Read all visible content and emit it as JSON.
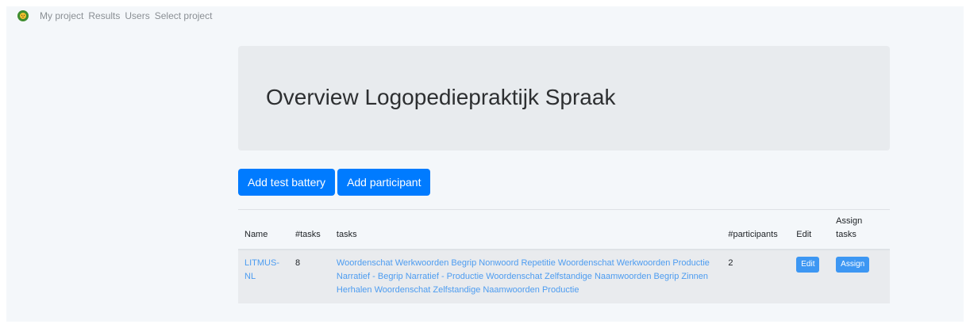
{
  "navbar": {
    "logo_icon": "lion-logo-icon",
    "links": [
      "My project",
      "Results",
      "Users",
      "Select project"
    ]
  },
  "jumbotron": {
    "title": "Overview Logopediepraktijk Spraak"
  },
  "actions": {
    "add_test_battery": "Add test battery",
    "add_participant": "Add participant"
  },
  "table": {
    "headers": {
      "name": "Name",
      "ntasks": "#tasks",
      "tasks": "tasks",
      "nparticipants": "#participants",
      "edit": "Edit",
      "assign": "Assign tasks"
    },
    "rows": [
      {
        "name": "LITMUS-NL",
        "ntasks": "8",
        "tasks": "Woordenschat Werkwoorden Begrip Nonwoord Repetitie Woordenschat Werkwoorden Productie Narratief - Begrip Narratief - Productie Woordenschat Zelfstandige Naamwoorden Begrip Zinnen Herhalen Woordenschat Zelfstandige Naamwoorden Productie",
        "nparticipants": "2",
        "edit_label": "Edit",
        "assign_label": "Assign"
      }
    ]
  },
  "colors": {
    "primary": "#007bff",
    "link": "#4d9cf0",
    "jumbotron_bg": "#e8ebee",
    "page_bg": "#f4f7fa"
  }
}
